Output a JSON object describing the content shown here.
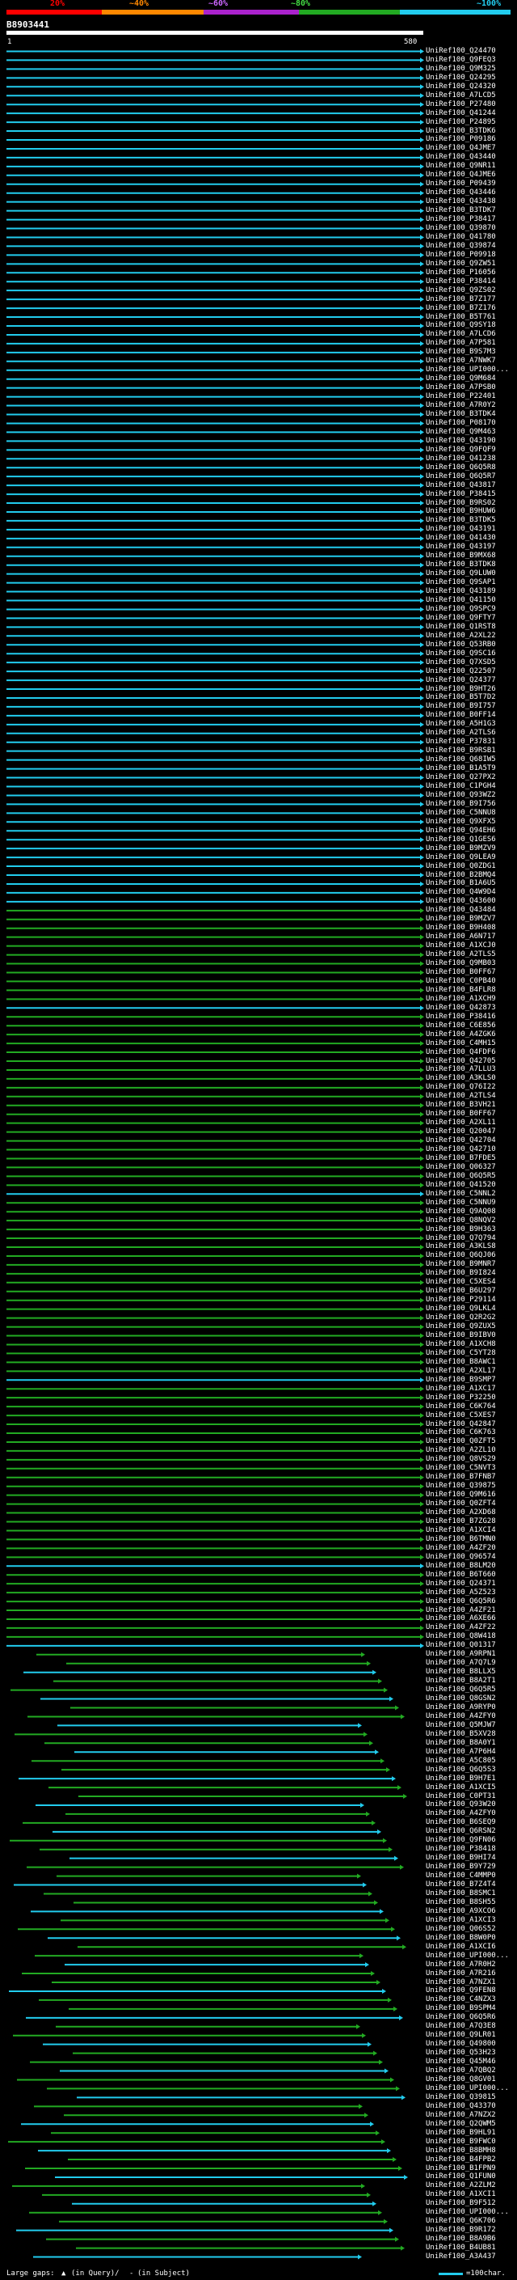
{
  "legend": {
    "labels": [
      "20%",
      "~40%",
      "~60%",
      "~80%",
      "~100%"
    ],
    "colors": [
      "#ff0000",
      "#ff8800",
      "#aa22cc",
      "#22aa22",
      "#22ccee"
    ]
  },
  "query": {
    "id": "B8903441",
    "start": "1",
    "end": "580"
  },
  "hits": [
    "UniRef100_Q24470",
    "UniRef100_Q9FEQ3",
    "UniRef100_Q9M325",
    "UniRef100_Q24295",
    "UniRef100_Q24320",
    "UniRef100_A7LCD5",
    "UniRef100_P27480",
    "UniRef100_Q41244",
    "UniRef100_P24895",
    "UniRef100_B3TDK6",
    "UniRef100_P09186",
    "UniRef100_Q4JME7",
    "UniRef100_Q43440",
    "UniRef100_Q9NR11",
    "UniRef100_Q4JME6",
    "UniRef100_P09439",
    "UniRef100_Q43446",
    "UniRef100_Q43438",
    "UniRef100_B3TDK7",
    "UniRef100_P38417",
    "UniRef100_Q39870",
    "UniRef100_Q41780",
    "UniRef100_Q39874",
    "UniRef100_P09918",
    "UniRef100_Q9ZW51",
    "UniRef100_P16056",
    "UniRef100_P38414",
    "UniRef100_Q9ZS02",
    "UniRef100_B7Z177",
    "UniRef100_B7Z176",
    "UniRef100_B5T761",
    "UniRef100_Q9SY18",
    "UniRef100_A7LCD6",
    "UniRef100_A7P581",
    "UniRef100_B9S7M3",
    "UniRef100_A7NWK7",
    "UniRef100_UPI000...",
    "UniRef100_Q9M684",
    "UniRef100_A7PSB0",
    "UniRef100_P22401",
    "UniRef100_A7R0Y2",
    "UniRef100_B3TDK4",
    "UniRef100_P08170",
    "UniRef100_Q9M463",
    "UniRef100_Q43190",
    "UniRef100_Q9FQF9",
    "UniRef100_Q41238",
    "UniRef100_Q6Q5R8",
    "UniRef100_Q6Q5R7",
    "UniRef100_Q43817",
    "UniRef100_P38415",
    "UniRef100_B9RS02",
    "UniRef100_B9HUW6",
    "UniRef100_B3TDK5",
    "UniRef100_Q43191",
    "UniRef100_Q41430",
    "UniRef100_Q43197",
    "UniRef100_B9MX68",
    "UniRef100_B3TDK8",
    "UniRef100_Q9LUW0",
    "UniRef100_Q9SAP1",
    "UniRef100_Q43189",
    "UniRef100_Q41150",
    "UniRef100_Q9SPC9",
    "UniRef100_Q9FTY7",
    "UniRef100_Q1RST8",
    "UniRef100_A2XL22",
    "UniRef100_Q53RB0",
    "UniRef100_Q9SC16",
    "UniRef100_Q7XSD5",
    "UniRef100_Q22507",
    "UniRef100_Q24377",
    "UniRef100_B9HT26",
    "UniRef100_B5T7D2",
    "UniRef100_B9I757",
    "UniRef100_B0FF14",
    "UniRef100_A5H1G3",
    "UniRef100_A2TLS6",
    "UniRef100_P37831",
    "UniRef100_B9RSB1",
    "UniRef100_Q68IW5",
    "UniRef100_B1A5T9",
    "UniRef100_Q27PX2",
    "UniRef100_C1PGH4",
    "UniRef100_Q93WZ2",
    "UniRef100_B9I756",
    "UniRef100_C5NNU8",
    "UniRef100_Q9XFX5",
    "UniRef100_Q94EH6",
    "UniRef100_Q1GES6",
    "UniRef100_B9MZV9",
    "UniRef100_Q9LEA9",
    "UniRef100_Q0ZDG1",
    "UniRef100_B2BMQ4",
    "UniRef100_B1A6U5",
    "UniRef100_Q4W9D4",
    "UniRef100_Q43600",
    "UniRef100_Q43484",
    "UniRef100_B9MZV7",
    "UniRef100_B9H408",
    "UniRef100_A6N717",
    "UniRef100_A1XCJ0",
    "UniRef100_A2TLS5",
    "UniRef100_Q9MB03",
    "UniRef100_B0FF67",
    "UniRef100_C0PB40",
    "UniRef100_B4FLR8",
    "UniRef100_A1XCH9",
    "UniRef100_Q42873",
    "UniRef100_P38416",
    "UniRef100_C6E856",
    "UniRef100_A4ZGK6",
    "UniRef100_C4MH15",
    "UniRef100_Q4FDF6",
    "UniRef100_Q42705",
    "UniRef100_A7LLU3",
    "UniRef100_A3KLS0",
    "UniRef100_Q76I22",
    "UniRef100_A2TLS4",
    "UniRef100_B3VH21",
    "UniRef100_B0FF67",
    "UniRef100_A2XL11",
    "UniRef100_Q20047",
    "UniRef100_Q42704",
    "UniRef100_Q42710",
    "UniRef100_B7FDE5",
    "UniRef100_Q06327",
    "UniRef100_Q6Q5R5",
    "UniRef100_Q41520",
    "UniRef100_C5NNL2",
    "UniRef100_C5NNU9",
    "UniRef100_Q9AQ08",
    "UniRef100_Q8NQV2",
    "UniRef100_B9H363",
    "UniRef100_Q7Q794",
    "UniRef100_A3KLS8",
    "UniRef100_Q6QJ06",
    "UniRef100_B9MNR7",
    "UniRef100_B9I824",
    "UniRef100_C5XES4",
    "UniRef100_B6U297",
    "UniRef100_P29114",
    "UniRef100_Q9LKL4",
    "UniRef100_Q2R2G2",
    "UniRef100_Q9ZUX5",
    "UniRef100_B9IBV0",
    "UniRef100_A1XCH8",
    "UniRef100_C5YT28",
    "UniRef100_B8AWC1",
    "UniRef100_A2XL17",
    "UniRef100_B9SMP7",
    "UniRef100_A1XC17",
    "UniRef100_P32250",
    "UniRef100_C6K764",
    "UniRef100_C5XES7",
    "UniRef100_Q42847",
    "UniRef100_C6K763",
    "UniRef100_Q0ZFT5",
    "UniRef100_A2ZL10",
    "UniRef100_Q8VS29",
    "UniRef100_C5NVT3",
    "UniRef100_B7FNB7",
    "UniRef100_Q39875",
    "UniRef100_Q9M616",
    "UniRef100_Q0ZFT4",
    "UniRef100_A2XD68",
    "UniRef100_B7ZG28",
    "UniRef100_A1XCI4",
    "UniRef100_B6TMN0",
    "UniRef100_A4ZF20",
    "UniRef100_Q96574",
    "UniRef100_B8LM20",
    "UniRef100_B6T660",
    "UniRef100_Q24371",
    "UniRef100_A5Z523",
    "UniRef100_Q6Q5R6",
    "UniRef100_A4ZF21",
    "UniRef100_A6XE66",
    "UniRef100_A4ZF22",
    "UniRef100_Q8W418",
    "UniRef100_Q01317",
    "UniRef100_A9RPN1",
    "UniRef100_A7Q7L9",
    "UniRef100_B8LLX5",
    "UniRef100_B8A2T1",
    "UniRef100_Q6Q5R5",
    "UniRef100_Q8GSN2",
    "UniRef100_A9RYP0",
    "UniRef100_A4ZFY0",
    "UniRef100_Q5MJW7",
    "UniRef100_B5XV28",
    "UniRef100_B8A0Y1",
    "UniRef100_A7P6H4",
    "UniRef100_A5C805",
    "UniRef100_Q6Q5S3",
    "UniRef100_B9H7E1",
    "UniRef100_A1XCI5",
    "UniRef100_C0PT31",
    "UniRef100_Q93W20",
    "UniRef100_A4ZFY0",
    "UniRef100_B6SEQ9",
    "UniRef100_Q6RSN2",
    "UniRef100_Q9FN06",
    "UniRef100_P38418",
    "UniRef100_B9HI74",
    "UniRef100_B9Y729",
    "UniRef100_C4MMP0",
    "UniRef100_B7Z4T4",
    "UniRef100_B8SMC1",
    "UniRef100_B8SH55",
    "UniRef100_A9XCO6",
    "UniRef100_A1XCI3",
    "UniRef100_Q06S52",
    "UniRef100_B8W0P0",
    "UniRef100_A1XCI6",
    "UniRef100_UPI000...",
    "UniRef100_A7R0H2",
    "UniRef100_A7R216",
    "UniRef100_A7NZX1",
    "UniRef100_Q9FEN8",
    "UniRef100_C4NZX3",
    "UniRef100_B9SPM4",
    "UniRef100_Q6Q5R6",
    "UniRef100_A7Q3E8",
    "UniRef100_Q9LR01",
    "UniRef100_Q49800",
    "UniRef100_Q53H23",
    "UniRef100_Q45M46",
    "UniRef100_A7QBQ2",
    "UniRef100_Q8GV01",
    "UniRef100_UPI000...",
    "UniRef100_Q39815",
    "UniRef100_Q43370",
    "UniRef100_A7NZX2",
    "UniRef100_Q2QWM5",
    "UniRef100_B9HL91",
    "UniRef100_B9FWC0",
    "UniRef100_B8BMH8",
    "UniRef100_B4FPB2",
    "UniRef100_B1FPN9",
    "UniRef100_Q1FUN0",
    "UniRef100_A2ZLM2",
    "UniRef100_A1XCI1",
    "UniRef100_B9F512",
    "UniRef100_UPI000...",
    "UniRef100_Q6K706",
    "UniRef100_B9R172",
    "UniRef100_B8A9B6",
    "UniRef100_B4UB81",
    "UniRef100_A3A437"
  ],
  "footer": {
    "gaps_label": "Large gaps:",
    "gaps_query": "(in Query)/",
    "gaps_subject": "(in Subject)",
    "scale_label": "=100char."
  }
}
